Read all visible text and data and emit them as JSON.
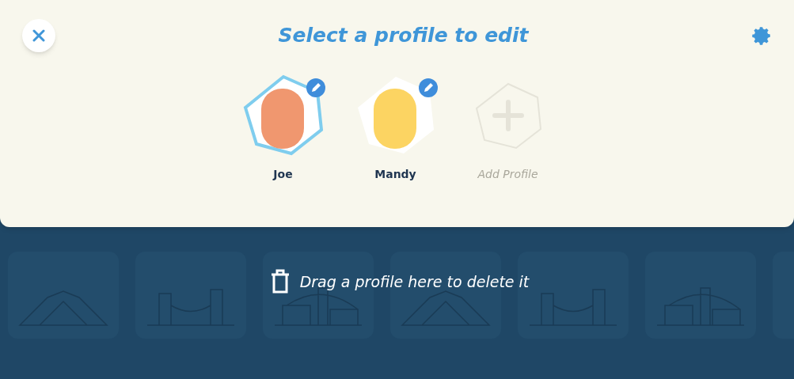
{
  "header": {
    "title": "Select a profile to edit"
  },
  "profiles": [
    {
      "name": "Joe",
      "selected": true,
      "color": "#f0976f"
    },
    {
      "name": "Mandy",
      "selected": false,
      "color": "#fcd462"
    }
  ],
  "add_profile": {
    "label": "Add Profile",
    "disabled": true
  },
  "delete_zone": {
    "text": "Drag a profile here to delete it"
  }
}
